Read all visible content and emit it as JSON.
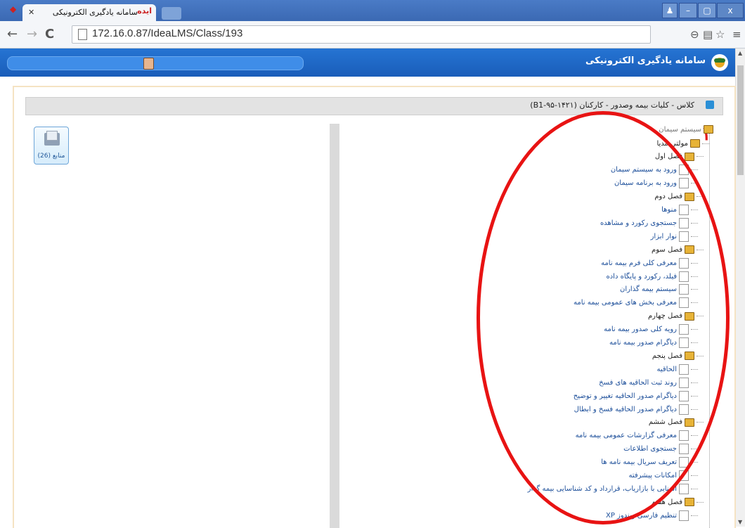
{
  "browser": {
    "tab_title": "سامانه یادگیری الکترونیکی",
    "tab_favicon": "ایده",
    "url": "172.16.0.87/IdeaLMS/Class/193"
  },
  "app": {
    "title": "سامانه یادگیری الکترونیکی"
  },
  "class_header": {
    "title": "کلاس - کلیات بیمه وصدور - کارکنان (۱۴۲۱-۹۵-B1)"
  },
  "resources": {
    "label": "منابع (26)"
  },
  "tree": {
    "root": "سیستم سیمان",
    "annotation": "۴",
    "items": [
      {
        "type": "chapter",
        "label": "مولتی مدیا"
      },
      {
        "type": "chapter",
        "label": "فصل اول"
      },
      {
        "type": "item",
        "label": "ورود به سیستم سیمان"
      },
      {
        "type": "item",
        "label": "ورود به برنامه سیمان"
      },
      {
        "type": "chapter",
        "label": "فصل دوم"
      },
      {
        "type": "item",
        "label": "منوها"
      },
      {
        "type": "item",
        "label": "جستجوی رکورد و مشاهده"
      },
      {
        "type": "item",
        "label": "نوار ابزار"
      },
      {
        "type": "chapter",
        "label": "فصل سوم"
      },
      {
        "type": "item",
        "label": "معرفی کلی فرم بیمه نامه"
      },
      {
        "type": "item",
        "label": "فیلد، رکورد و پایگاه داده"
      },
      {
        "type": "item",
        "label": "سیستم بیمه گذاران"
      },
      {
        "type": "item",
        "label": "معرفی بخش های عمومی بیمه نامه"
      },
      {
        "type": "chapter",
        "label": "فصل چهارم"
      },
      {
        "type": "item",
        "label": "رویه کلی صدور بیمه نامه"
      },
      {
        "type": "item",
        "label": "دیاگرام صدور بیمه نامه"
      },
      {
        "type": "chapter",
        "label": "فصل پنجم"
      },
      {
        "type": "item",
        "label": "الحاقیه"
      },
      {
        "type": "item",
        "label": "روند ثبت الحاقیه های فسخ"
      },
      {
        "type": "item",
        "label": "دیاگرام صدور الحاقیه تغییر و توضیح"
      },
      {
        "type": "item",
        "label": "دیاگرام صدور الحاقیه فسخ و ابطال"
      },
      {
        "type": "chapter",
        "label": "فصل ششم"
      },
      {
        "type": "item",
        "label": "معرفی گزارشات عمومی بیمه نامه"
      },
      {
        "type": "item",
        "label": "جستجوی اطلاعات"
      },
      {
        "type": "item",
        "label": "تعریف سریال بیمه نامه ها"
      },
      {
        "type": "item",
        "label": "امکانات پیشرفته"
      },
      {
        "type": "item",
        "label": "آشنایی با بازاریاب، قرارداد و کد شناسایی بیمه گذار"
      },
      {
        "type": "chapter",
        "label": "فصل هفتم"
      },
      {
        "type": "item",
        "label": "تنظیم فارسی ویندوز XP"
      }
    ]
  }
}
